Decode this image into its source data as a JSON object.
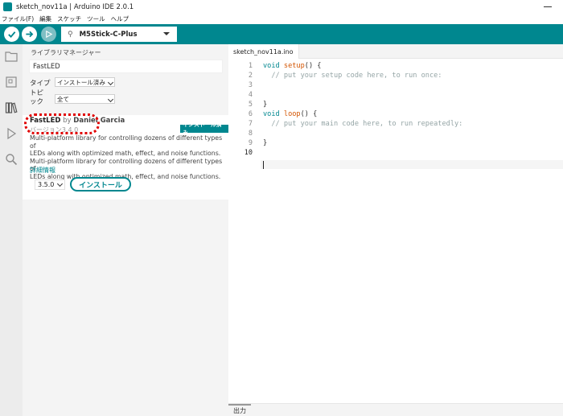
{
  "window": {
    "title": "sketch_nov11a | Arduino IDE 2.0.1"
  },
  "menubar": {
    "items": [
      "ファイル(F)",
      "編集",
      "スケッチ",
      "ツール",
      "ヘルプ"
    ]
  },
  "toolbar": {
    "board": "M5Stick-C-Plus",
    "accent": "#00878f"
  },
  "activity_bar": {
    "icons": [
      "folder-icon",
      "board-icon",
      "library-icon",
      "debug-icon",
      "search-icon"
    ]
  },
  "library_manager": {
    "title": "ライブラリマネージャー",
    "search_value": "FastLED",
    "type_label": "タイプ",
    "type_value": "インストール済み",
    "topic_label": "トピック",
    "topic_value": "全て",
    "result": {
      "name": "FastLED",
      "by": "by",
      "author": "Daniel Garcia",
      "version_text": "バージョン3.4.0",
      "installed_badge": "インストール済み",
      "description_lines": [
        "Multi-platform library for controlling dozens of different types of",
        "LEDs along with optimized math, effect, and noise functions.",
        "Multi-platform library for controlling dozens of different types of",
        "LEDs along with optimized math, effect, and noise functions."
      ],
      "more_info": "詳細情報",
      "selected_version": "3.5.0",
      "install_button": "インストール"
    }
  },
  "editor": {
    "tab": "sketch_nov11a.ino",
    "line_numbers": [
      "1",
      "2",
      "3",
      "4",
      "5",
      "6",
      "7",
      "8",
      "9",
      "10"
    ],
    "active_line": "10",
    "code": {
      "l1_kw": "void",
      "l1_fn": "setup",
      "l1_rest": "() {",
      "l2_comment": "  // put your setup code here, to run once:",
      "l5": "}",
      "l6_kw": "void",
      "l6_fn": "loop",
      "l6_rest": "() {",
      "l7_comment": "  // put your main code here, to run repeatedly:",
      "l9": "}"
    }
  },
  "output": {
    "tab": "出力"
  }
}
